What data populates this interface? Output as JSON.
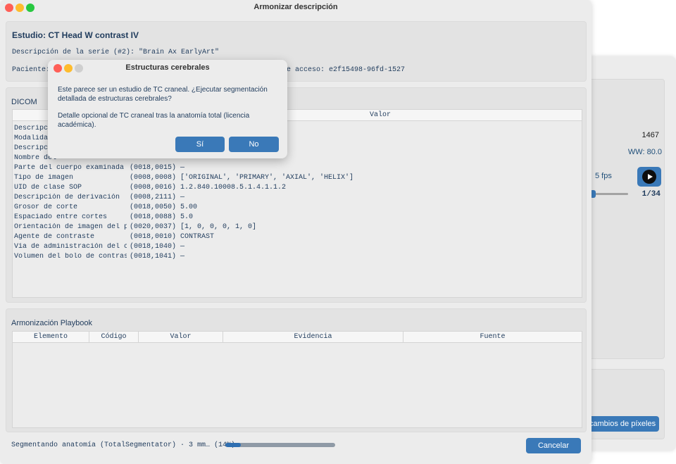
{
  "window": {
    "title": "Armonizar descripción"
  },
  "study": {
    "title": "Estudio: CT Head W contrast IV",
    "series_description": "Descripción de la serie (#2): \"Brain Ax EarlyArt\"",
    "patient_label": "Paciente:",
    "access_number": "e acceso: e2f15498-96fd-1527"
  },
  "dicom": {
    "label": "DICOM",
    "value_header": "Valor",
    "rows": [
      {
        "name": "Descripci",
        "tag": "",
        "value": ""
      },
      {
        "name": "Modalidad",
        "tag": "",
        "value": ""
      },
      {
        "name": "Descripci",
        "tag": "",
        "value": ""
      },
      {
        "name": "Nombre del",
        "tag": "",
        "value": ""
      },
      {
        "name": "Parte del cuerpo examinada",
        "tag": "(0018,0015)",
        "value": "—"
      },
      {
        "name": "Tipo de imagen",
        "tag": "(0008,0008)",
        "value": "['ORIGINAL', 'PRIMARY', 'AXIAL', 'HELIX']"
      },
      {
        "name": "UID de clase SOP",
        "tag": "(0008,0016)",
        "value": "1.2.840.10008.5.1.4.1.1.2"
      },
      {
        "name": "Descripción de derivación",
        "tag": "(0008,2111)",
        "value": "—"
      },
      {
        "name": "Grosor de corte",
        "tag": "(0018,0050)",
        "value": "5.00"
      },
      {
        "name": "Espaciado entre cortes",
        "tag": "(0018,0088)",
        "value": "5.0"
      },
      {
        "name": "Orientación de imagen del pac",
        "tag": "(0020,0037)",
        "value": "[1, 0, 0, 0, 1, 0]"
      },
      {
        "name": "Agente de contraste",
        "tag": "(0018,0010)",
        "value": "CONTRAST"
      },
      {
        "name": "Vía de administración del con",
        "tag": "(0018,1040)",
        "value": "—"
      },
      {
        "name": "Volumen del bolo de contraste",
        "tag": "(0018,1041)",
        "value": "—"
      }
    ]
  },
  "playbook": {
    "label": "Armonización Playbook",
    "columns": [
      "Elemento",
      "Código",
      "Valor",
      "Evidencia",
      "Fuente"
    ]
  },
  "status": {
    "text": "Segmentando anatomía (TotalSegmentator) · 3 mm… (14%)",
    "progress": 0.14,
    "cancel_label": "Cancelar"
  },
  "dialog": {
    "title": "Estructuras cerebrales",
    "message": "Este parece ser un estudio de TC craneal. ¿Ejecutar segmentación detallada de estructuras cerebrales?",
    "detail": "Detalle opcional de TC craneal tras la anatomía total (licencia académica).",
    "yes_label": "Sí",
    "no_label": "No"
  },
  "background_window": {
    "number": "1467",
    "ww": "WW: 80.0",
    "fps": "5 fps",
    "frame": "1/34",
    "pixels_button": "cambios de píxeles"
  },
  "colors": {
    "accent": "#3a79b8",
    "text": "#1f3b5c",
    "progress_fill": "#2f6fb1"
  }
}
